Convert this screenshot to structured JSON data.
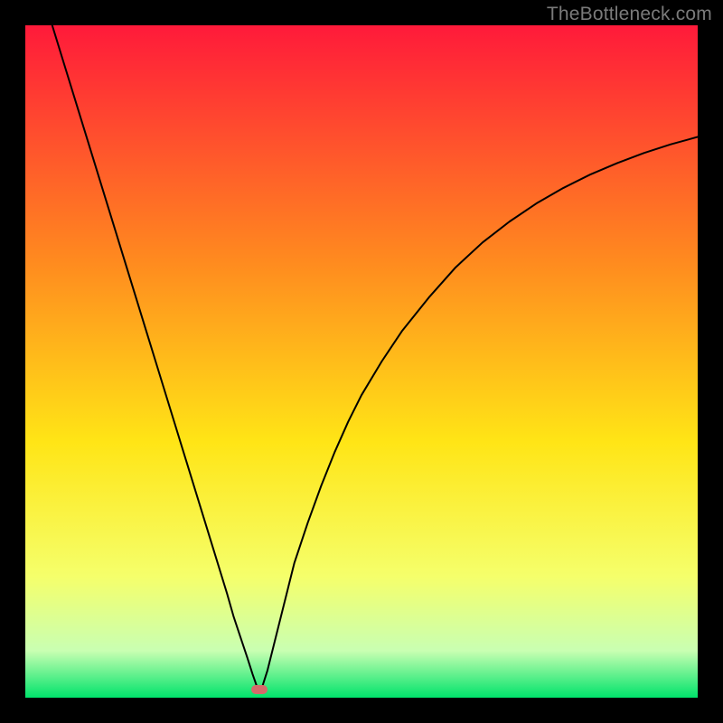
{
  "watermark": "TheBottleneck.com",
  "chart_data": {
    "type": "line",
    "title": "",
    "xlabel": "",
    "ylabel": "",
    "xlim": [
      0,
      100
    ],
    "ylim": [
      0,
      100
    ],
    "grid": false,
    "legend": false,
    "background_gradient": {
      "top_color": "#ff1a3a",
      "mid_top_color": "#ff8a1f",
      "mid_color": "#ffe516",
      "mid_bottom_color": "#f5ff6b",
      "near_bottom_color": "#c9ffb2",
      "bottom_color": "#00e36b"
    },
    "series": [
      {
        "name": "bottleneck-curve",
        "color": "#000000",
        "stroke_width": 2,
        "x": [
          4,
          6,
          8,
          10,
          12,
          14,
          16,
          18,
          20,
          22,
          24,
          26,
          28,
          30,
          31,
          32,
          33,
          33.8,
          34.5,
          35.2,
          36,
          37,
          38,
          39,
          40,
          42,
          44,
          46,
          48,
          50,
          53,
          56,
          60,
          64,
          68,
          72,
          76,
          80,
          84,
          88,
          92,
          96,
          100
        ],
        "y": [
          100,
          93.5,
          87,
          80.5,
          74,
          67.5,
          61,
          54.5,
          48,
          41.5,
          35,
          28.5,
          22,
          15.5,
          12,
          9,
          6,
          3.5,
          1.5,
          1.5,
          4,
          8,
          12,
          16,
          20,
          26,
          31.5,
          36.5,
          41,
          45,
          50,
          54.5,
          59.5,
          64,
          67.7,
          70.8,
          73.5,
          75.8,
          77.8,
          79.5,
          81,
          82.3,
          83.4
        ]
      }
    ],
    "marker": {
      "name": "optimum-point",
      "color": "#d46a6a",
      "x": 34.8,
      "y": 1.2
    }
  }
}
